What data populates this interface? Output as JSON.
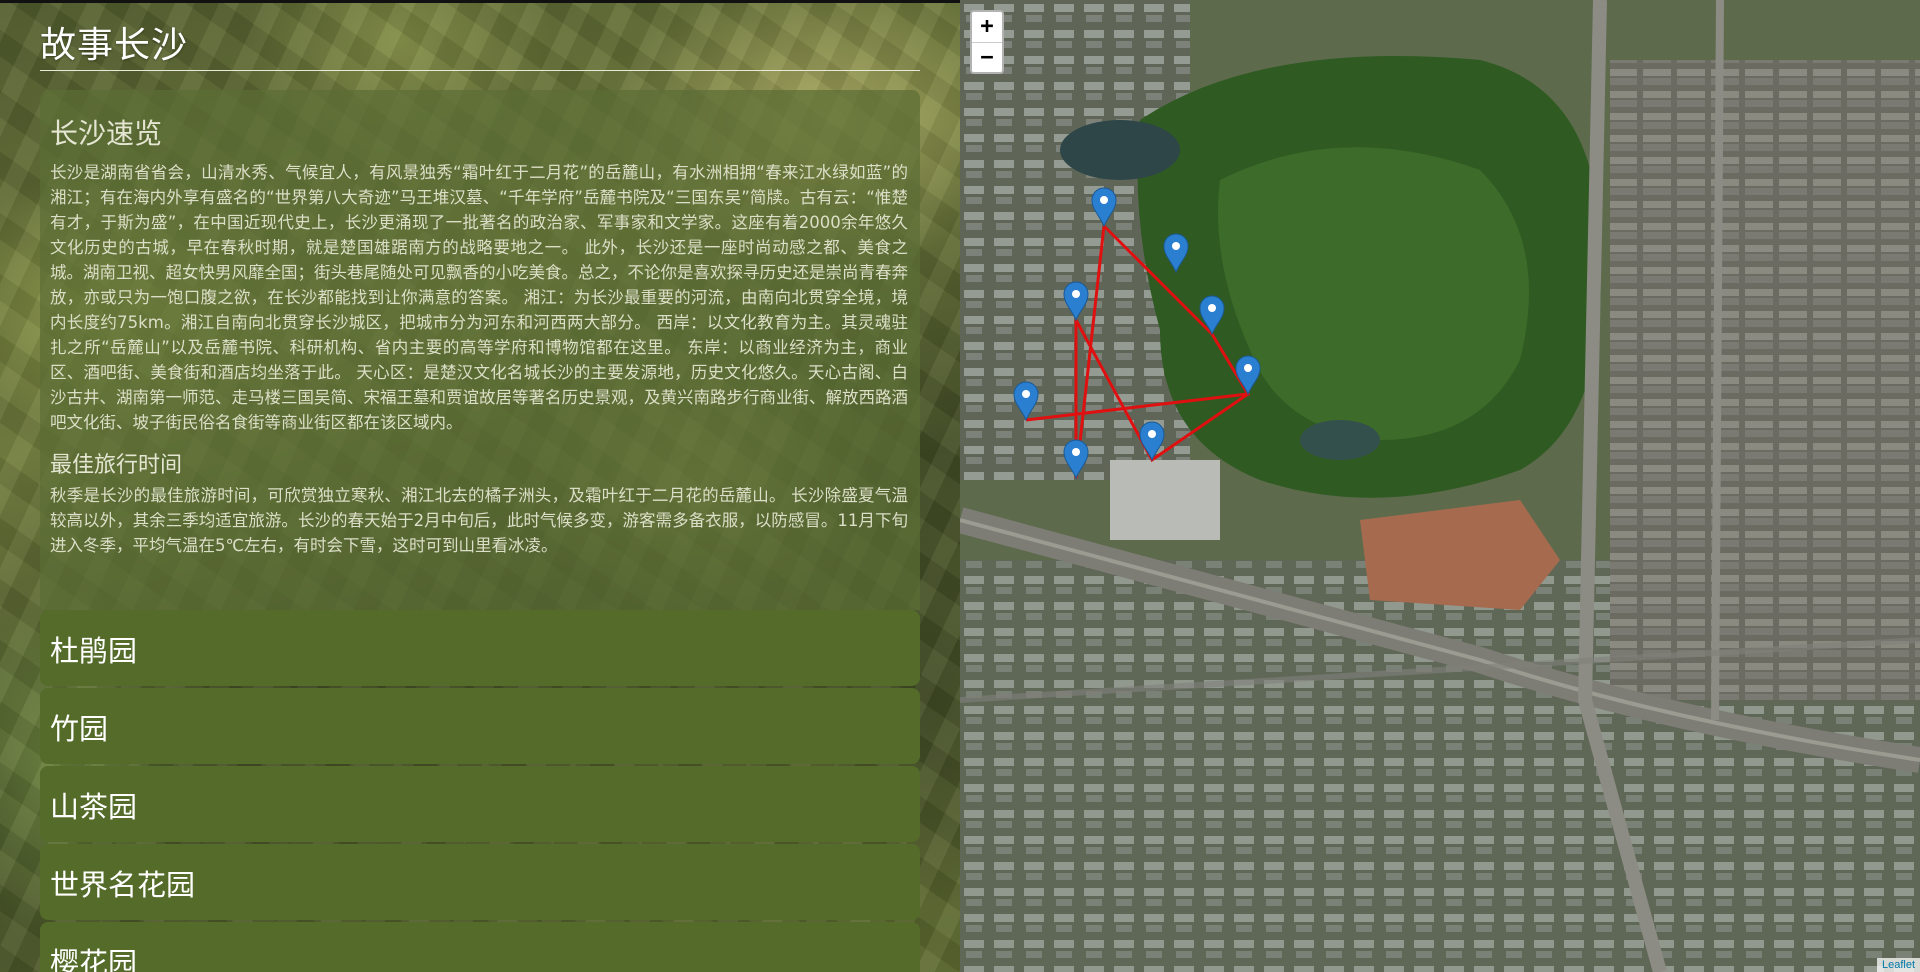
{
  "app": {
    "title": "故事长沙"
  },
  "overview": {
    "heading": "长沙速览",
    "body": "长沙是湖南省省会，山清水秀、气候宜人，有风景独秀“霜叶红于二月花”的岳麓山，有水洲相拥“春来江水绿如蓝”的湘江；有在海内外享有盛名的“世界第八大奇迹”马王堆汉墓、“千年学府”岳麓书院及“三国东吴”简牍。古有云：“惟楚有才，于斯为盛”，在中国近现代史上，长沙更涌现了一批著名的政治家、军事家和文学家。这座有着2000余年悠久文化历史的古城，早在春秋时期，就是楚国雄踞南方的战略要地之一。 此外，长沙还是一座时尚动感之都、美食之城。湖南卫视、超女快男风靡全国；街头巷尾随处可见飘香的小吃美食。总之，不论你是喜欢探寻历史还是崇尚青春奔放，亦或只为一饱口腹之欲，在长沙都能找到让你满意的答案。 湘江：为长沙最重要的河流，由南向北贯穿全境，境内长度约75km。湘江自南向北贯穿长沙城区，把城市分为河东和河西两大部分。 西岸：以文化教育为主。其灵魂驻扎之所“岳麓山”以及岳麓书院、科研机构、省内主要的高等学府和博物馆都在这里。 东岸：以商业经济为主，商业区、酒吧街、美食街和酒店均坐落于此。 天心区：是楚汉文化名城长沙的主要发源地，历史文化悠久。天心古阁、白沙古井、湖南第一师范、走马楼三国吴简、宋福王墓和贾谊故居等著名历史景观，及黄兴南路步行商业街、解放西路酒吧文化街、坡子街民俗名食街等商业街区都在该区域内。",
    "best_heading": "最佳旅行时间",
    "best_body": "秋季是长沙的最佳旅游时间，可欣赏独立寒秋、湘江北去的橘子洲头，及霜叶红于二月花的岳麓山。 长沙除盛夏气温较高以外，其余三季均适宜旅游。长沙的春天始于2月中旬后，此时气候多变，游客需多备衣服，以防感冒。11月下旬进入冬季，平均气温在5℃左右，有时会下雪，这时可到山里看冰凌。"
  },
  "gardens": [
    {
      "label": "杜鹃园"
    },
    {
      "label": "竹园"
    },
    {
      "label": "山茶园"
    },
    {
      "label": "世界名花园"
    },
    {
      "label": "樱花园"
    }
  ],
  "map": {
    "zoom_in": "+",
    "zoom_out": "−",
    "attribution": "Leaflet",
    "route_color": "#e01010",
    "marker_color": "#2a7fd0",
    "marker_count": 8
  }
}
